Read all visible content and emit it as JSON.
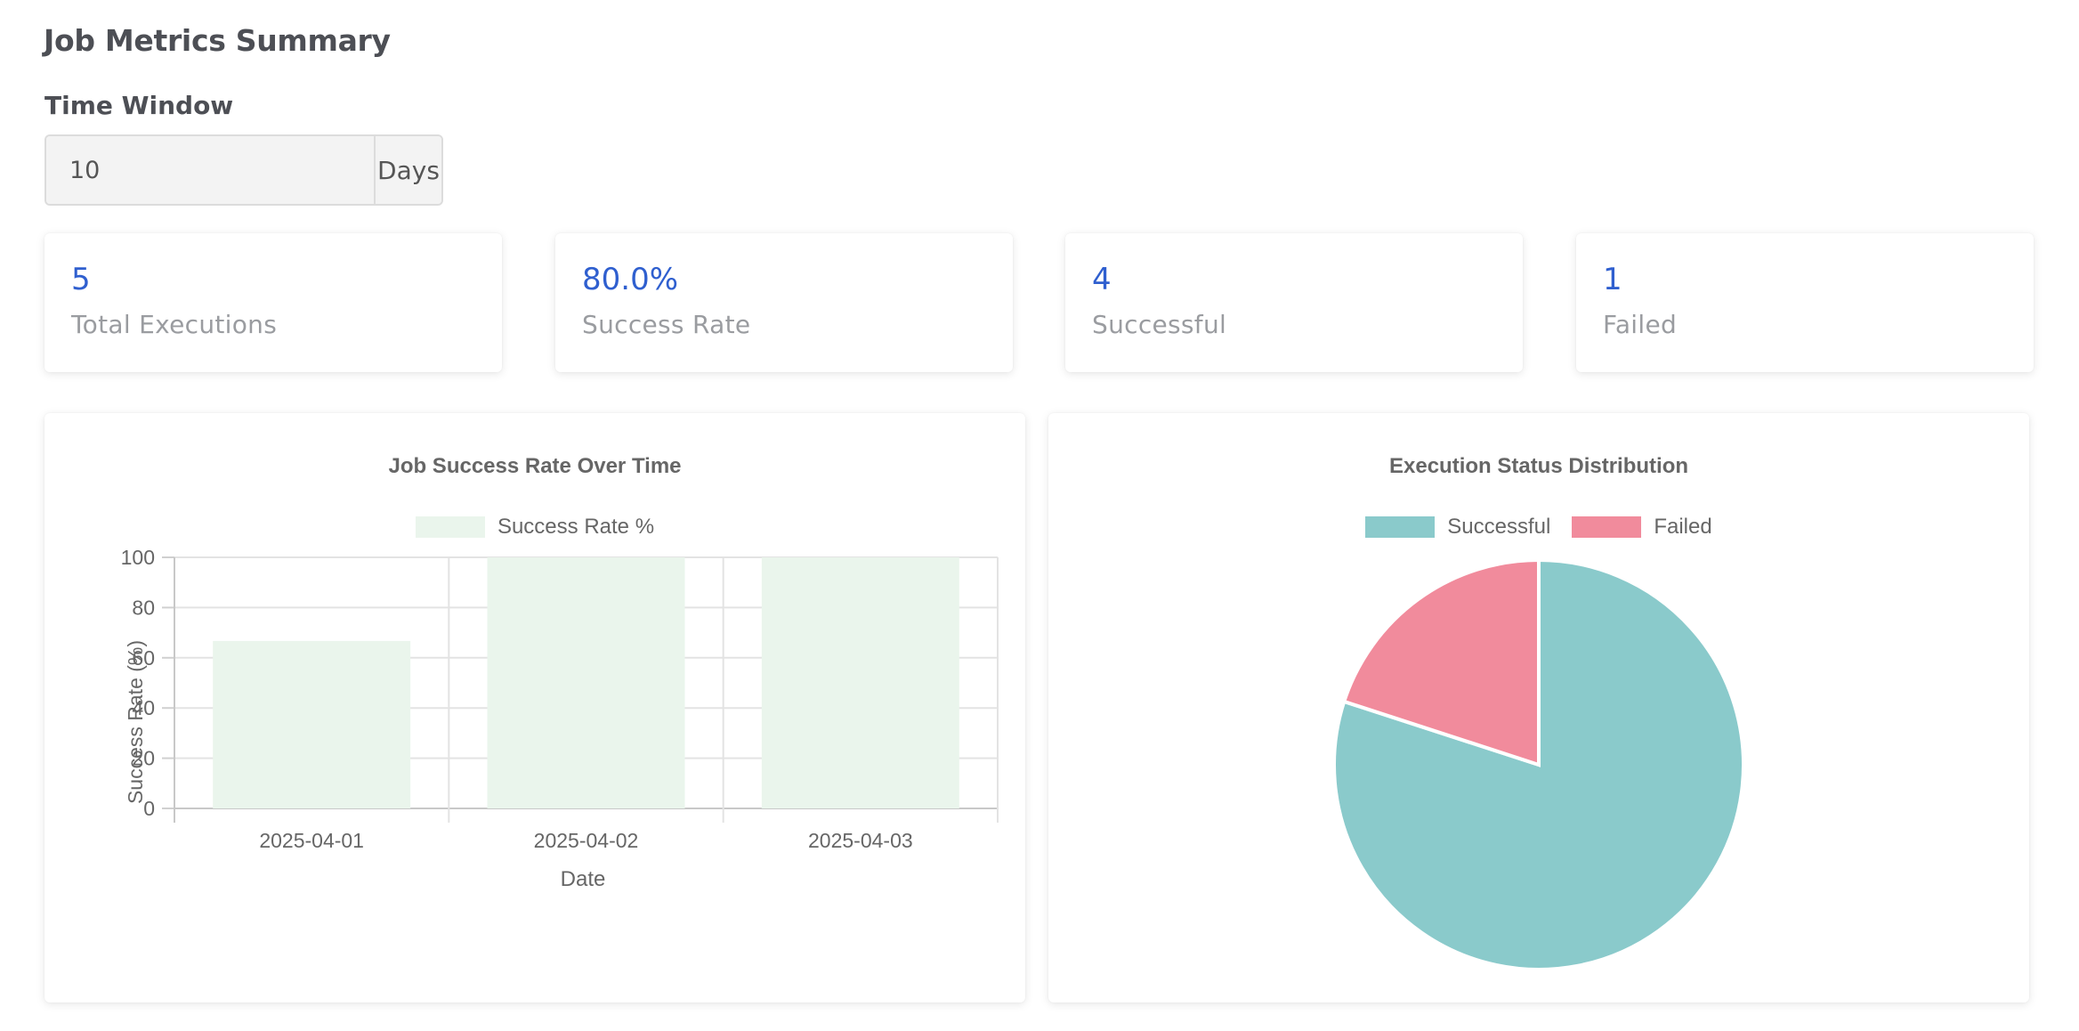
{
  "header": {
    "title": "Job Metrics Summary"
  },
  "time_window": {
    "label": "Time Window",
    "value": "10",
    "unit": "Days"
  },
  "stats": [
    {
      "value": "5",
      "label": "Total Executions"
    },
    {
      "value": "80.0%",
      "label": "Success Rate"
    },
    {
      "value": "4",
      "label": "Successful"
    },
    {
      "value": "1",
      "label": "Failed"
    }
  ],
  "colors": {
    "accent": "#2f5fcf",
    "bar_fill": "#eaf5ec",
    "successful": "#8acacb",
    "failed": "#f18b9c"
  },
  "chart_data": [
    {
      "type": "bar",
      "title": "Job Success Rate Over Time",
      "categories": [
        "2025-04-01",
        "2025-04-02",
        "2025-04-03"
      ],
      "series": [
        {
          "name": "Success Rate %",
          "values": [
            66.7,
            100,
            100
          ]
        }
      ],
      "xlabel": "Date",
      "ylabel": "Success Rate (%)",
      "ylim": [
        0,
        100
      ],
      "yticks": [
        0,
        20,
        40,
        60,
        80,
        100
      ],
      "grid": true,
      "legend": "top"
    },
    {
      "type": "pie",
      "title": "Execution Status Distribution",
      "labels": [
        "Successful",
        "Failed"
      ],
      "values": [
        4,
        1
      ],
      "legend": "top"
    }
  ]
}
